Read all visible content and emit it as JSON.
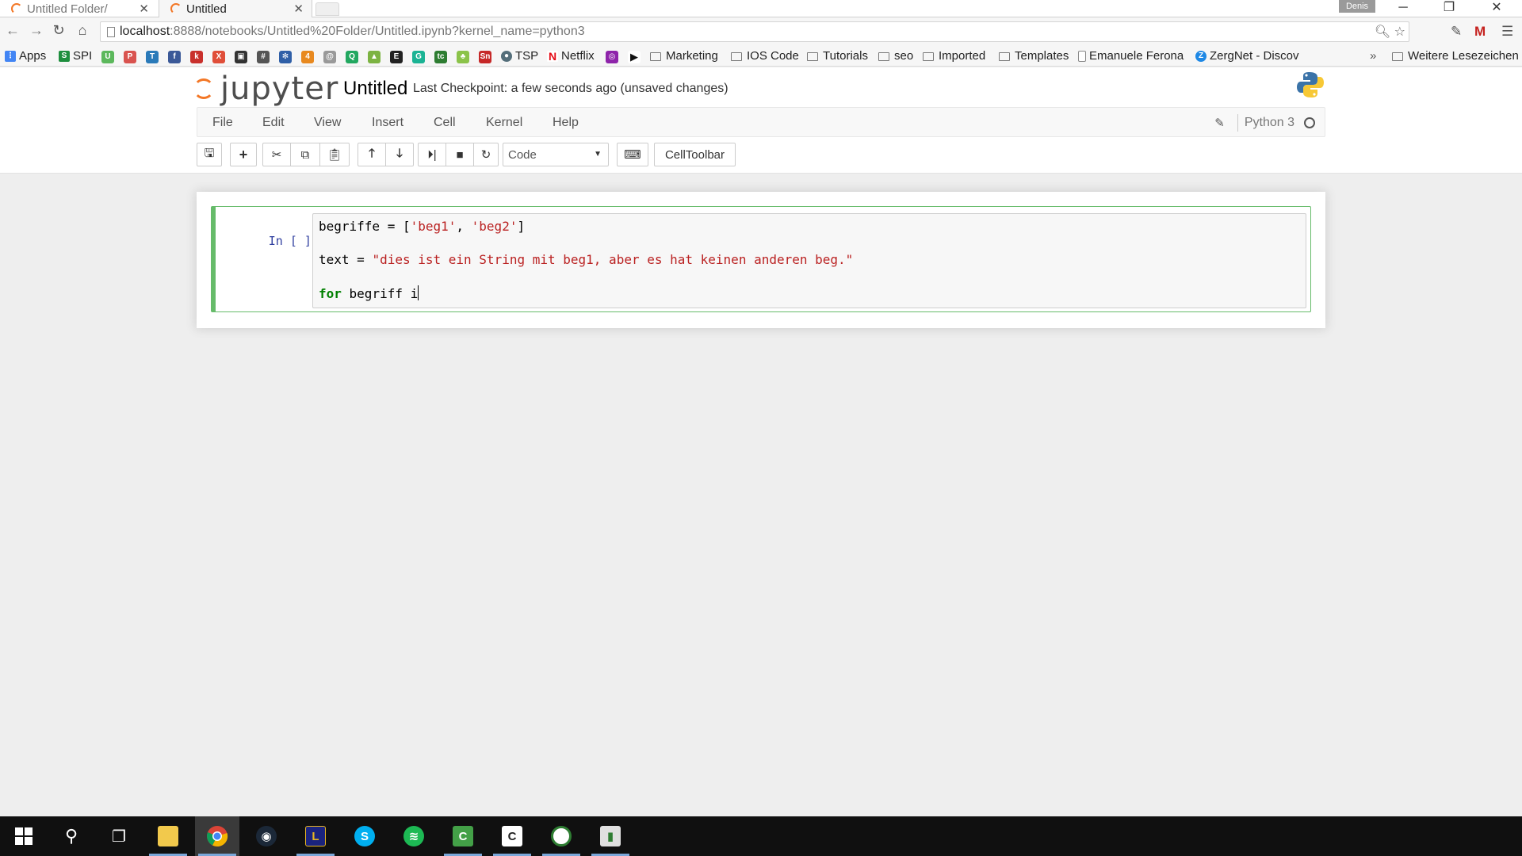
{
  "browser": {
    "tabs": [
      {
        "label": "Untitled Folder/",
        "active": false
      },
      {
        "label": "Untitled",
        "active": true
      }
    ],
    "profile_name": "Denis",
    "url_host": "localhost",
    "url_path": ":8888/notebooks/Untitled%20Folder/Untitled.ipynb?kernel_name=python3"
  },
  "bookmarks": {
    "apps": "Apps",
    "spi": "SPI",
    "tsp": "TSP",
    "netflix": "Netflix",
    "folders": [
      "Marketing",
      "IOS Code",
      "Tutorials",
      "seo",
      "Imported",
      "Templates"
    ],
    "emanuele": "Emanuele Ferona",
    "zergnet": "ZergNet - Discov",
    "overflow": "»",
    "other": "Weitere Lesezeichen"
  },
  "notebook": {
    "logo_text": "jupyter",
    "name": "Untitled",
    "checkpoint": "Last Checkpoint: a few seconds ago (unsaved changes)",
    "kernel_name": "Python 3"
  },
  "menu": [
    "File",
    "Edit",
    "View",
    "Insert",
    "Cell",
    "Kernel",
    "Help"
  ],
  "toolbar": {
    "cell_type": "Code",
    "celltoolbar_label": "CellToolbar"
  },
  "cell": {
    "prompt": "In [ ]:",
    "line1_var": "begriffe = [",
    "line1_s1": "'beg1'",
    "line1_sep": ", ",
    "line1_s2": "'beg2'",
    "line1_end": "]",
    "line2_var": "text = ",
    "line2_str": "\"dies ist ein String mit beg1, aber es hat keinen anderen beg.\"",
    "line3_kw": "for",
    "line3_rest": " begriff i"
  },
  "colors": {
    "jupyter_orange": "#f37726",
    "cell_edit_border": "#66bb6a",
    "string": "#ba2121",
    "keyword": "#008000",
    "prompt": "#303f9f"
  }
}
